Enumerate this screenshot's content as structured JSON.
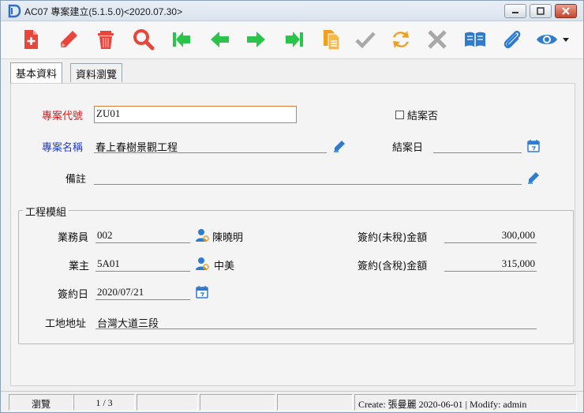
{
  "window": {
    "title": "AC07 專案建立(5.1.5.0)<2020.07.30>"
  },
  "toolbar": {
    "buttons": [
      {
        "name": "new-icon",
        "color": "#e8463b"
      },
      {
        "name": "edit-icon",
        "color": "#e8463b"
      },
      {
        "name": "delete-icon",
        "color": "#e8463b"
      },
      {
        "name": "search-icon",
        "color": "#e8463b"
      },
      {
        "name": "first-record-icon",
        "color": "#2bc44a"
      },
      {
        "name": "previous-record-icon",
        "color": "#2bc44a"
      },
      {
        "name": "next-record-icon",
        "color": "#2bc44a"
      },
      {
        "name": "last-record-icon",
        "color": "#2bc44a"
      },
      {
        "name": "copy-icon",
        "color": "#f0a020"
      },
      {
        "name": "confirm-icon",
        "color": "#a8a8a8"
      },
      {
        "name": "refresh-icon",
        "color": "#f0a020"
      },
      {
        "name": "cancel-icon",
        "color": "#a8a8a8"
      },
      {
        "name": "book-icon",
        "color": "#2e7bd0"
      },
      {
        "name": "attachment-icon",
        "color": "#2e7bd0"
      },
      {
        "name": "view-icon",
        "color": "#2e7bd0"
      }
    ]
  },
  "tabs": [
    {
      "label": "基本資料",
      "active": true
    },
    {
      "label": "資料瀏覽",
      "active": false
    }
  ],
  "form": {
    "project_code_label": "專案代號",
    "project_code_value": "ZU01",
    "closed_checkbox_label": "結案否",
    "closed_checked": false,
    "project_name_label": "專案名稱",
    "project_name_value": "春上春樹景觀工程",
    "close_date_label": "結案日",
    "close_date_value": "",
    "note_label": "備註",
    "note_value": ""
  },
  "group": {
    "title": "工程模組",
    "salesperson_label": "業務員",
    "salesperson_code": "002",
    "salesperson_name": "陳曉明",
    "owner_label": "業主",
    "owner_code": "5A01",
    "owner_name": "中美",
    "sign_date_label": "簽約日",
    "sign_date_value": "2020/07/21",
    "address_label": "工地地址",
    "address_value": "台灣大道三段",
    "amount_pretax_label": "簽約(未稅)金額",
    "amount_pretax_value": "300,000",
    "amount_taxed_label": "簽約(含稅)金額",
    "amount_taxed_value": "315,000"
  },
  "statusbar": {
    "mode": "瀏覽",
    "record_position": "1 / 3",
    "audit": "Create: 張曼麗  2020-06-01 | Modify: admin"
  },
  "colors": {
    "required_label": "#d21a1a",
    "link_label": "#1f3cc8",
    "focus_border": "#e07a3a",
    "person_icon": "#2e7bd0"
  }
}
